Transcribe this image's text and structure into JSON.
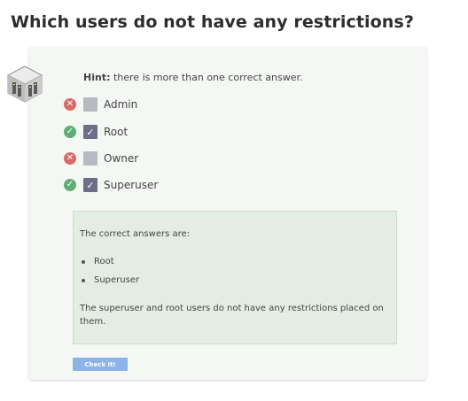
{
  "question": {
    "title": "Which users do not have any restrictions?"
  },
  "hint": {
    "label": "Hint:",
    "text": " there is more than one correct answer."
  },
  "options": [
    {
      "label": "Admin",
      "checked": false,
      "result": "wrong"
    },
    {
      "label": "Root",
      "checked": true,
      "result": "correct"
    },
    {
      "label": "Owner",
      "checked": false,
      "result": "wrong"
    },
    {
      "label": "Superuser",
      "checked": true,
      "result": "correct"
    }
  ],
  "icons": {
    "wrong": "✕",
    "correct": "✓",
    "checkmark": "✓"
  },
  "feedback": {
    "intro": "The correct answers are:",
    "answers": [
      "Root",
      "Superuser"
    ],
    "explanation": "The superuser and root users do not have any restrictions placed on them."
  },
  "actions": {
    "check_label": "Check It!"
  },
  "colors": {
    "wrong": "#d96a6a",
    "correct": "#5fae76",
    "checked_box": "#6d6f86",
    "unchecked_box": "#b9b9c2",
    "button": "#8cb4e8",
    "feedback_bg": "#e3ede3"
  }
}
